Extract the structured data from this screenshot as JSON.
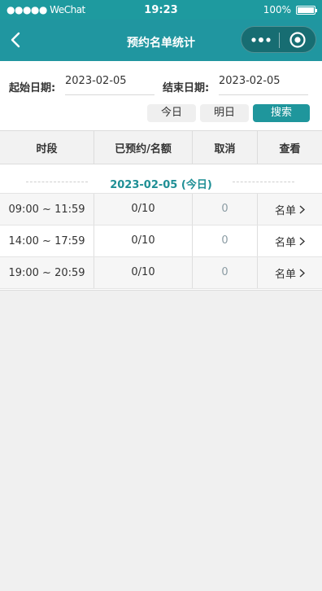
{
  "status_bar": {
    "signal": "●●●●● WeChat",
    "time": "19:23",
    "battery": "100%"
  },
  "nav": {
    "title": "预约名单统计"
  },
  "search": {
    "start_label": "起始日期:",
    "start_value": "2023-02-05",
    "end_label": "结束日期:",
    "end_value": "2023-02-05",
    "today_button": "今日",
    "tomorrow_button": "明日",
    "search_button": "搜索"
  },
  "table": {
    "headers": [
      "时段",
      "已预约/名额",
      "取消",
      "查看"
    ],
    "date_group": "2023-02-05 (今日)",
    "rows": [
      {
        "time": "09:00 ~ 11:59",
        "booked": "0/10",
        "cancel": "0",
        "view": "名单"
      },
      {
        "time": "14:00 ~ 17:59",
        "booked": "0/10",
        "cancel": "0",
        "view": "名单"
      },
      {
        "time": "19:00 ~ 20:59",
        "booked": "0/10",
        "cancel": "0",
        "view": "名单"
      }
    ]
  },
  "colors": {
    "accent": "#1f969c",
    "date_text": "#1f8f95"
  }
}
